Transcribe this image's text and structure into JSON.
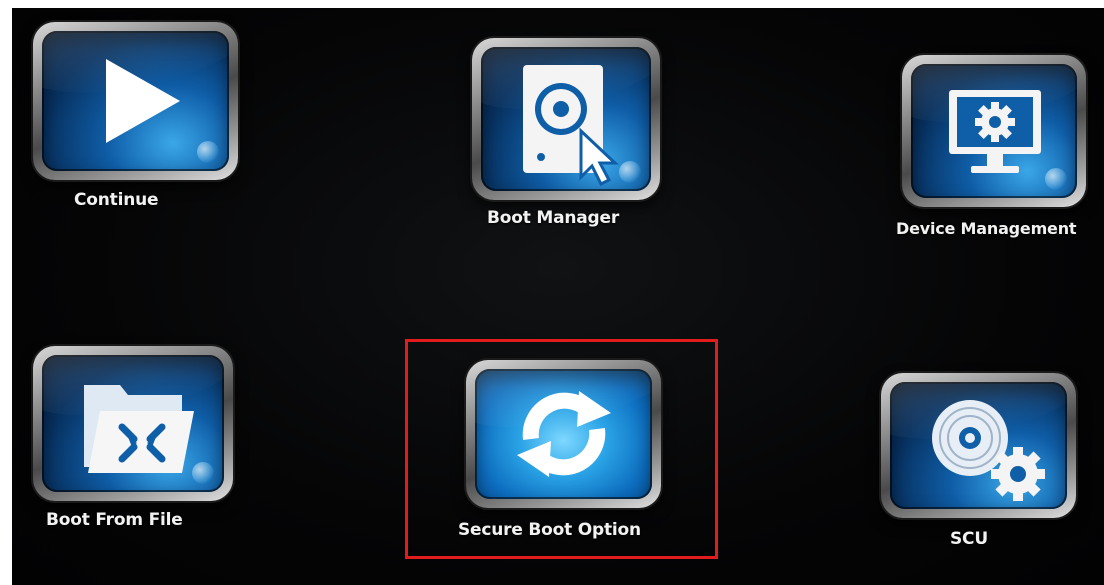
{
  "menu": {
    "items": [
      {
        "id": "continue",
        "label": "Continue",
        "icon": "play-icon"
      },
      {
        "id": "boot-manager",
        "label": "Boot Manager",
        "icon": "boot-disk-pointer-icon"
      },
      {
        "id": "device-management",
        "label": "Device Management",
        "icon": "monitor-gear-icon"
      },
      {
        "id": "boot-from-file",
        "label": "Boot From File",
        "icon": "folder-arrows-icon"
      },
      {
        "id": "secure-boot-option",
        "label": "Secure Boot Option",
        "icon": "refresh-arrows-icon"
      },
      {
        "id": "scu",
        "label": "SCU",
        "icon": "disc-gear-icon"
      }
    ],
    "selected": "Secure Boot Option"
  },
  "colors": {
    "background": "#050506",
    "tile_blue": "#0f5ea8",
    "highlight_border": "#e01c1c",
    "label_text": "#f2f2f2"
  }
}
